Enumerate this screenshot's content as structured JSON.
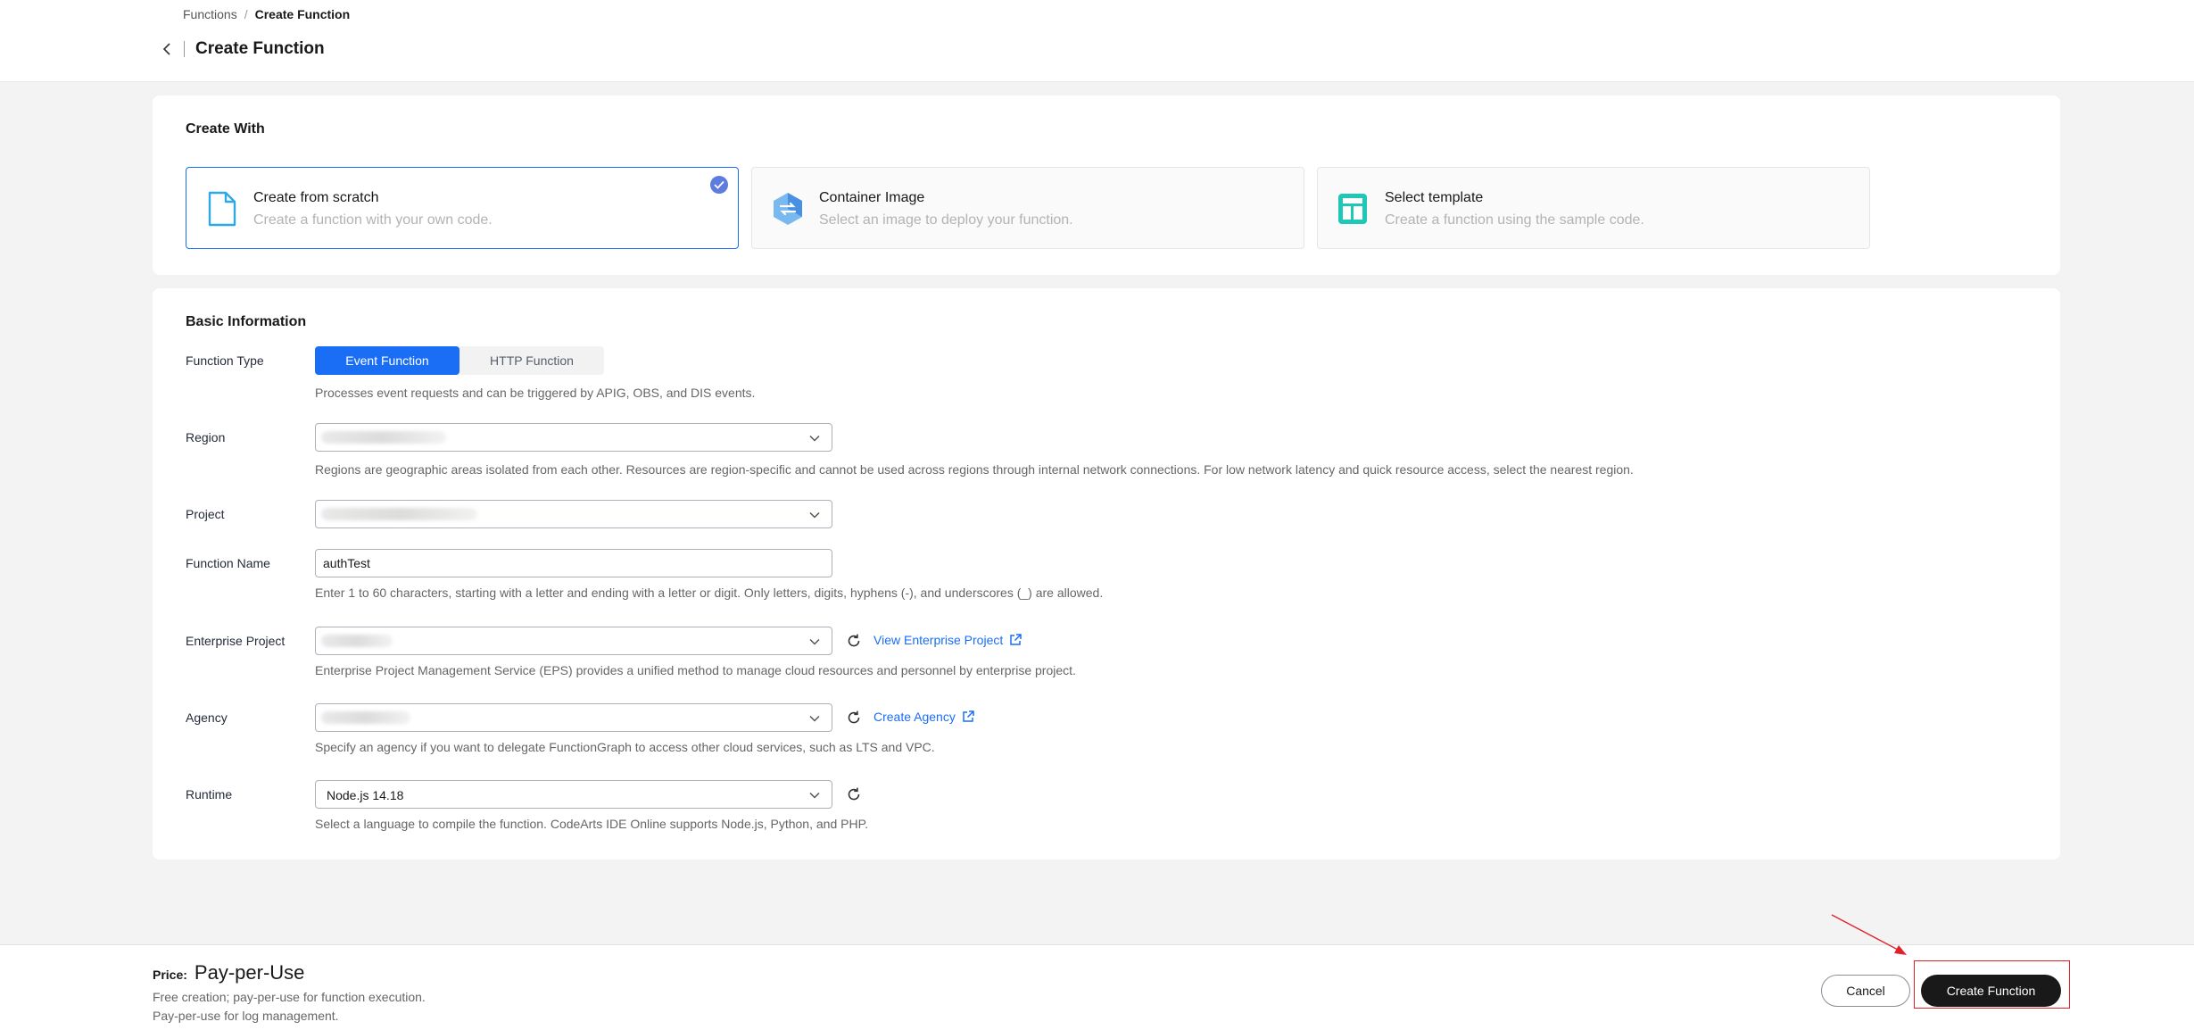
{
  "header": {
    "breadcrumb": {
      "parent": "Functions",
      "separator": "/",
      "current": "Create Function"
    },
    "title": "Create Function"
  },
  "create_with": {
    "title": "Create With",
    "options": [
      {
        "title": "Create from scratch",
        "desc": "Create a function with your own code.",
        "icon": "document-icon",
        "selected": true
      },
      {
        "title": "Container Image",
        "desc": "Select an image to deploy your function.",
        "icon": "container-icon",
        "selected": false
      },
      {
        "title": "Select template",
        "desc": "Create a function using the sample code.",
        "icon": "template-icon",
        "selected": false
      }
    ]
  },
  "basic": {
    "title": "Basic Information",
    "function_type": {
      "label": "Function Type",
      "options": [
        "Event Function",
        "HTTP Function"
      ],
      "selected": "Event Function",
      "helper": "Processes event requests and can be triggered by APIG, OBS, and DIS events."
    },
    "region": {
      "label": "Region",
      "helper": "Regions are geographic areas isolated from each other. Resources are region-specific and cannot be used across regions through internal network connections. For low network latency and quick resource access, select the nearest region."
    },
    "project": {
      "label": "Project"
    },
    "function_name": {
      "label": "Function Name",
      "value": "authTest",
      "helper": "Enter 1 to 60 characters, starting with a letter and ending with a letter or digit. Only letters, digits, hyphens (-), and underscores (_) are allowed."
    },
    "enterprise_project": {
      "label": "Enterprise Project",
      "link": "View Enterprise Project",
      "helper": "Enterprise Project Management Service (EPS) provides a unified method to manage cloud resources and personnel by enterprise project."
    },
    "agency": {
      "label": "Agency",
      "link": "Create Agency",
      "helper": "Specify an agency if you want to delegate FunctionGraph to access other cloud services, such as LTS and VPC."
    },
    "runtime": {
      "label": "Runtime",
      "value": "Node.js 14.18",
      "helper": "Select a language to compile the function. CodeArts IDE Online supports Node.js, Python, and PHP."
    }
  },
  "footer": {
    "price_label": "Price:",
    "price_value": "Pay-per-Use",
    "notes": [
      "Free creation; pay-per-use for function execution.",
      "Pay-per-use for log management."
    ],
    "cancel": "Cancel",
    "create": "Create Function"
  },
  "colors": {
    "primary": "#1a6ef5",
    "annotation": "#e0212b",
    "dark_button": "#191919"
  }
}
